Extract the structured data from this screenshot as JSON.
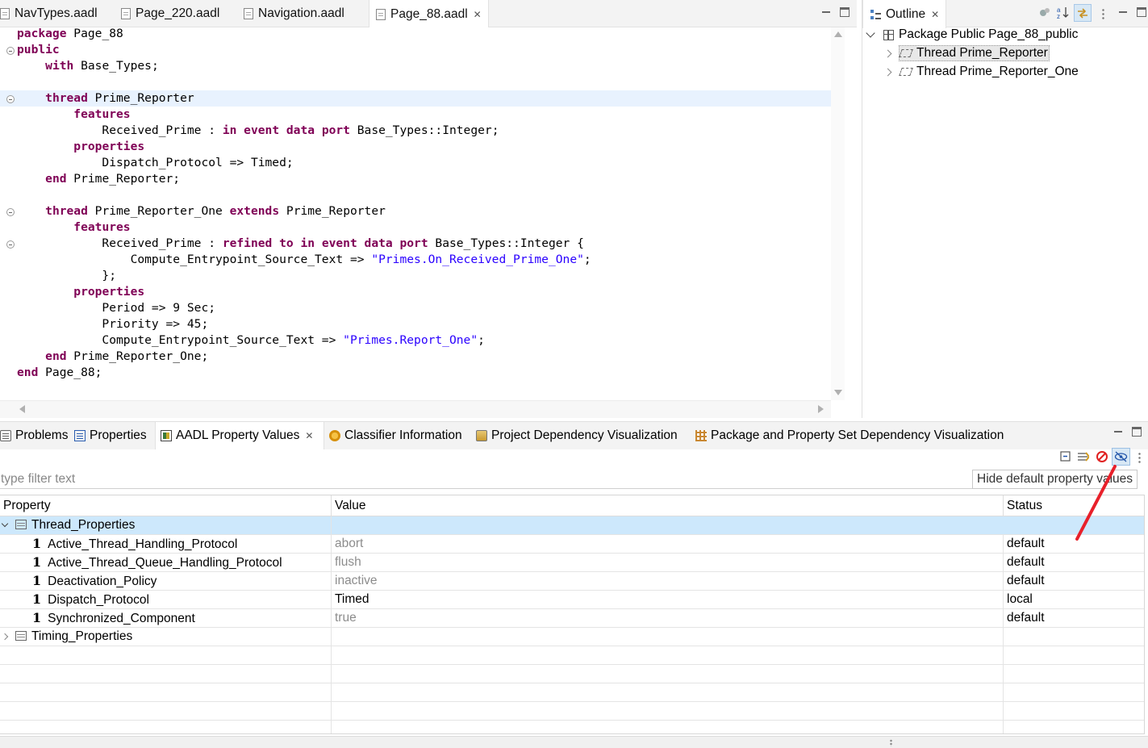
{
  "editor": {
    "tabs": [
      {
        "label": "NavTypes.aadl",
        "active": false
      },
      {
        "label": "Page_220.aadl",
        "active": false
      },
      {
        "label": "Navigation.aadl",
        "active": false
      },
      {
        "label": "Page_88.aadl",
        "active": true
      }
    ],
    "code_lines": [
      {
        "segments": [
          {
            "t": "package",
            "k": "kw"
          },
          {
            "t": " Page_88"
          }
        ]
      },
      {
        "segments": [
          {
            "t": "public",
            "k": "kw"
          }
        ]
      },
      {
        "segments": [
          {
            "t": "    "
          },
          {
            "t": "with",
            "k": "kw"
          },
          {
            "t": " Base_Types;"
          }
        ]
      },
      {
        "segments": [
          {
            "t": ""
          }
        ]
      },
      {
        "segments": [
          {
            "t": "    "
          },
          {
            "t": "thread",
            "k": "kw"
          },
          {
            "t": " Prime_Reporter"
          }
        ]
      },
      {
        "segments": [
          {
            "t": "        "
          },
          {
            "t": "features",
            "k": "kw"
          }
        ]
      },
      {
        "segments": [
          {
            "t": "            Received_Prime : "
          },
          {
            "t": "in event data port",
            "k": "kw"
          },
          {
            "t": " Base_Types::Integer;"
          }
        ]
      },
      {
        "segments": [
          {
            "t": "        "
          },
          {
            "t": "properties",
            "k": "kw"
          }
        ]
      },
      {
        "segments": [
          {
            "t": "            Dispatch_Protocol => Timed;"
          }
        ]
      },
      {
        "segments": [
          {
            "t": "    "
          },
          {
            "t": "end",
            "k": "kw"
          },
          {
            "t": " Prime_Reporter;"
          }
        ]
      },
      {
        "segments": [
          {
            "t": ""
          }
        ]
      },
      {
        "segments": [
          {
            "t": "    "
          },
          {
            "t": "thread",
            "k": "kw"
          },
          {
            "t": " Prime_Reporter_One "
          },
          {
            "t": "extends",
            "k": "kw"
          },
          {
            "t": " Prime_Reporter"
          }
        ]
      },
      {
        "segments": [
          {
            "t": "        "
          },
          {
            "t": "features",
            "k": "kw"
          }
        ]
      },
      {
        "segments": [
          {
            "t": "            Received_Prime : "
          },
          {
            "t": "refined to in event data port",
            "k": "kw"
          },
          {
            "t": " Base_Types::Integer {"
          }
        ]
      },
      {
        "segments": [
          {
            "t": "                Compute_Entrypoint_Source_Text => "
          },
          {
            "t": "\"Primes.On_Received_Prime_One\"",
            "k": "str"
          },
          {
            "t": ";"
          }
        ]
      },
      {
        "segments": [
          {
            "t": "            };"
          }
        ]
      },
      {
        "segments": [
          {
            "t": "        "
          },
          {
            "t": "properties",
            "k": "kw"
          }
        ]
      },
      {
        "segments": [
          {
            "t": "            Period => 9 Sec;"
          }
        ]
      },
      {
        "segments": [
          {
            "t": "            Priority => 45;"
          }
        ]
      },
      {
        "segments": [
          {
            "t": "            Compute_Entrypoint_Source_Text => "
          },
          {
            "t": "\"Primes.Report_One\"",
            "k": "str"
          },
          {
            "t": ";"
          }
        ]
      },
      {
        "segments": [
          {
            "t": "    "
          },
          {
            "t": "end",
            "k": "kw"
          },
          {
            "t": " Prime_Reporter_One;"
          }
        ]
      },
      {
        "segments": [
          {
            "t": "end",
            "k": "kw"
          },
          {
            "t": " Page_88;"
          }
        ]
      }
    ]
  },
  "outline": {
    "title": "Outline",
    "root": "Package Public Page_88_public",
    "items": [
      "Thread Prime_Reporter",
      "Thread Prime_Reporter_One"
    ]
  },
  "bottom": {
    "tabs": [
      {
        "label": "Problems",
        "icon": "problems-icon"
      },
      {
        "label": "Properties",
        "icon": "properties-icon"
      },
      {
        "label": "AADL Property Values",
        "icon": "aadl-icon",
        "active": true
      },
      {
        "label": "Classifier Information",
        "icon": "classifier-icon"
      },
      {
        "label": "Project Dependency Visualization",
        "icon": "project-icon"
      },
      {
        "label": "Package and Property Set Dependency Visualization",
        "icon": "package-set-icon"
      }
    ],
    "filter_placeholder": "type filter text",
    "tooltip": "Hide default property values",
    "columns": {
      "property": "Property",
      "value": "Value",
      "status": "Status"
    },
    "groups": [
      {
        "name": "Thread_Properties",
        "expanded": true,
        "rows": [
          {
            "property": "Active_Thread_Handling_Protocol",
            "value": "abort",
            "status": "default"
          },
          {
            "property": "Active_Thread_Queue_Handling_Protocol",
            "value": "flush",
            "status": "default"
          },
          {
            "property": "Deactivation_Policy",
            "value": "inactive",
            "status": "default"
          },
          {
            "property": "Dispatch_Protocol",
            "value": "Timed",
            "status": "local"
          },
          {
            "property": "Synchronized_Component",
            "value": "true",
            "status": "default"
          }
        ]
      },
      {
        "name": "Timing_Properties",
        "expanded": false,
        "rows": []
      }
    ],
    "property_icon_glyph": "1"
  },
  "colors": {
    "keyword": "#7f0055",
    "string": "#2a00ff",
    "selection": "#cde8fc",
    "annotation_arrow": "#e8202a"
  }
}
